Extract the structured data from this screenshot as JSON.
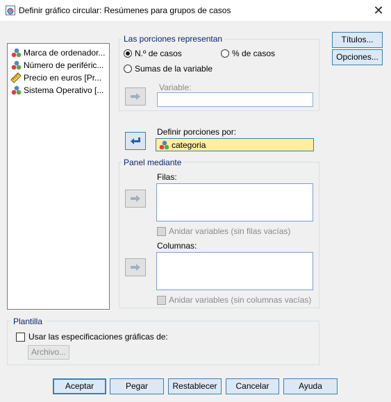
{
  "window": {
    "title": "Definir gráfico circular: Resúmenes para grupos de casos",
    "close_glyph": "✕"
  },
  "variables": [
    {
      "label": "Marca de ordenador...",
      "icon": "nominal-icon"
    },
    {
      "label": "Número de periféric...",
      "icon": "nominal-icon"
    },
    {
      "label": "Precio en euros [Pr...",
      "icon": "scale-ruler-icon"
    },
    {
      "label": "Sistema Operativo [...",
      "icon": "nominal-icon"
    }
  ],
  "slices_represent": {
    "legend": "Las porciones representan",
    "options": [
      {
        "label": "N.º de casos",
        "selected": true
      },
      {
        "label": "% de casos",
        "selected": false
      },
      {
        "label": "Sumas de la variable",
        "selected": false
      }
    ],
    "variable_label": "Variable:"
  },
  "define_slices": {
    "label": "Definir porciones por:",
    "value": "categoria"
  },
  "panel": {
    "legend": "Panel mediante",
    "rows_label": "Filas:",
    "rows_nest": "Anidar variables (sin filas vacías)",
    "cols_label": "Columnas:",
    "cols_nest": "Anidar variables (sin columnas vacías)"
  },
  "side_buttons": {
    "titles": "Títulos...",
    "options": "Opciones..."
  },
  "template": {
    "legend": "Plantilla",
    "use_spec": "Usar las especificaciones gráficas de:",
    "file_button": "Archivo..."
  },
  "footer": {
    "ok": "Aceptar",
    "paste": "Pegar",
    "reset": "Restablecer",
    "cancel": "Cancelar",
    "help": "Ayuda"
  }
}
